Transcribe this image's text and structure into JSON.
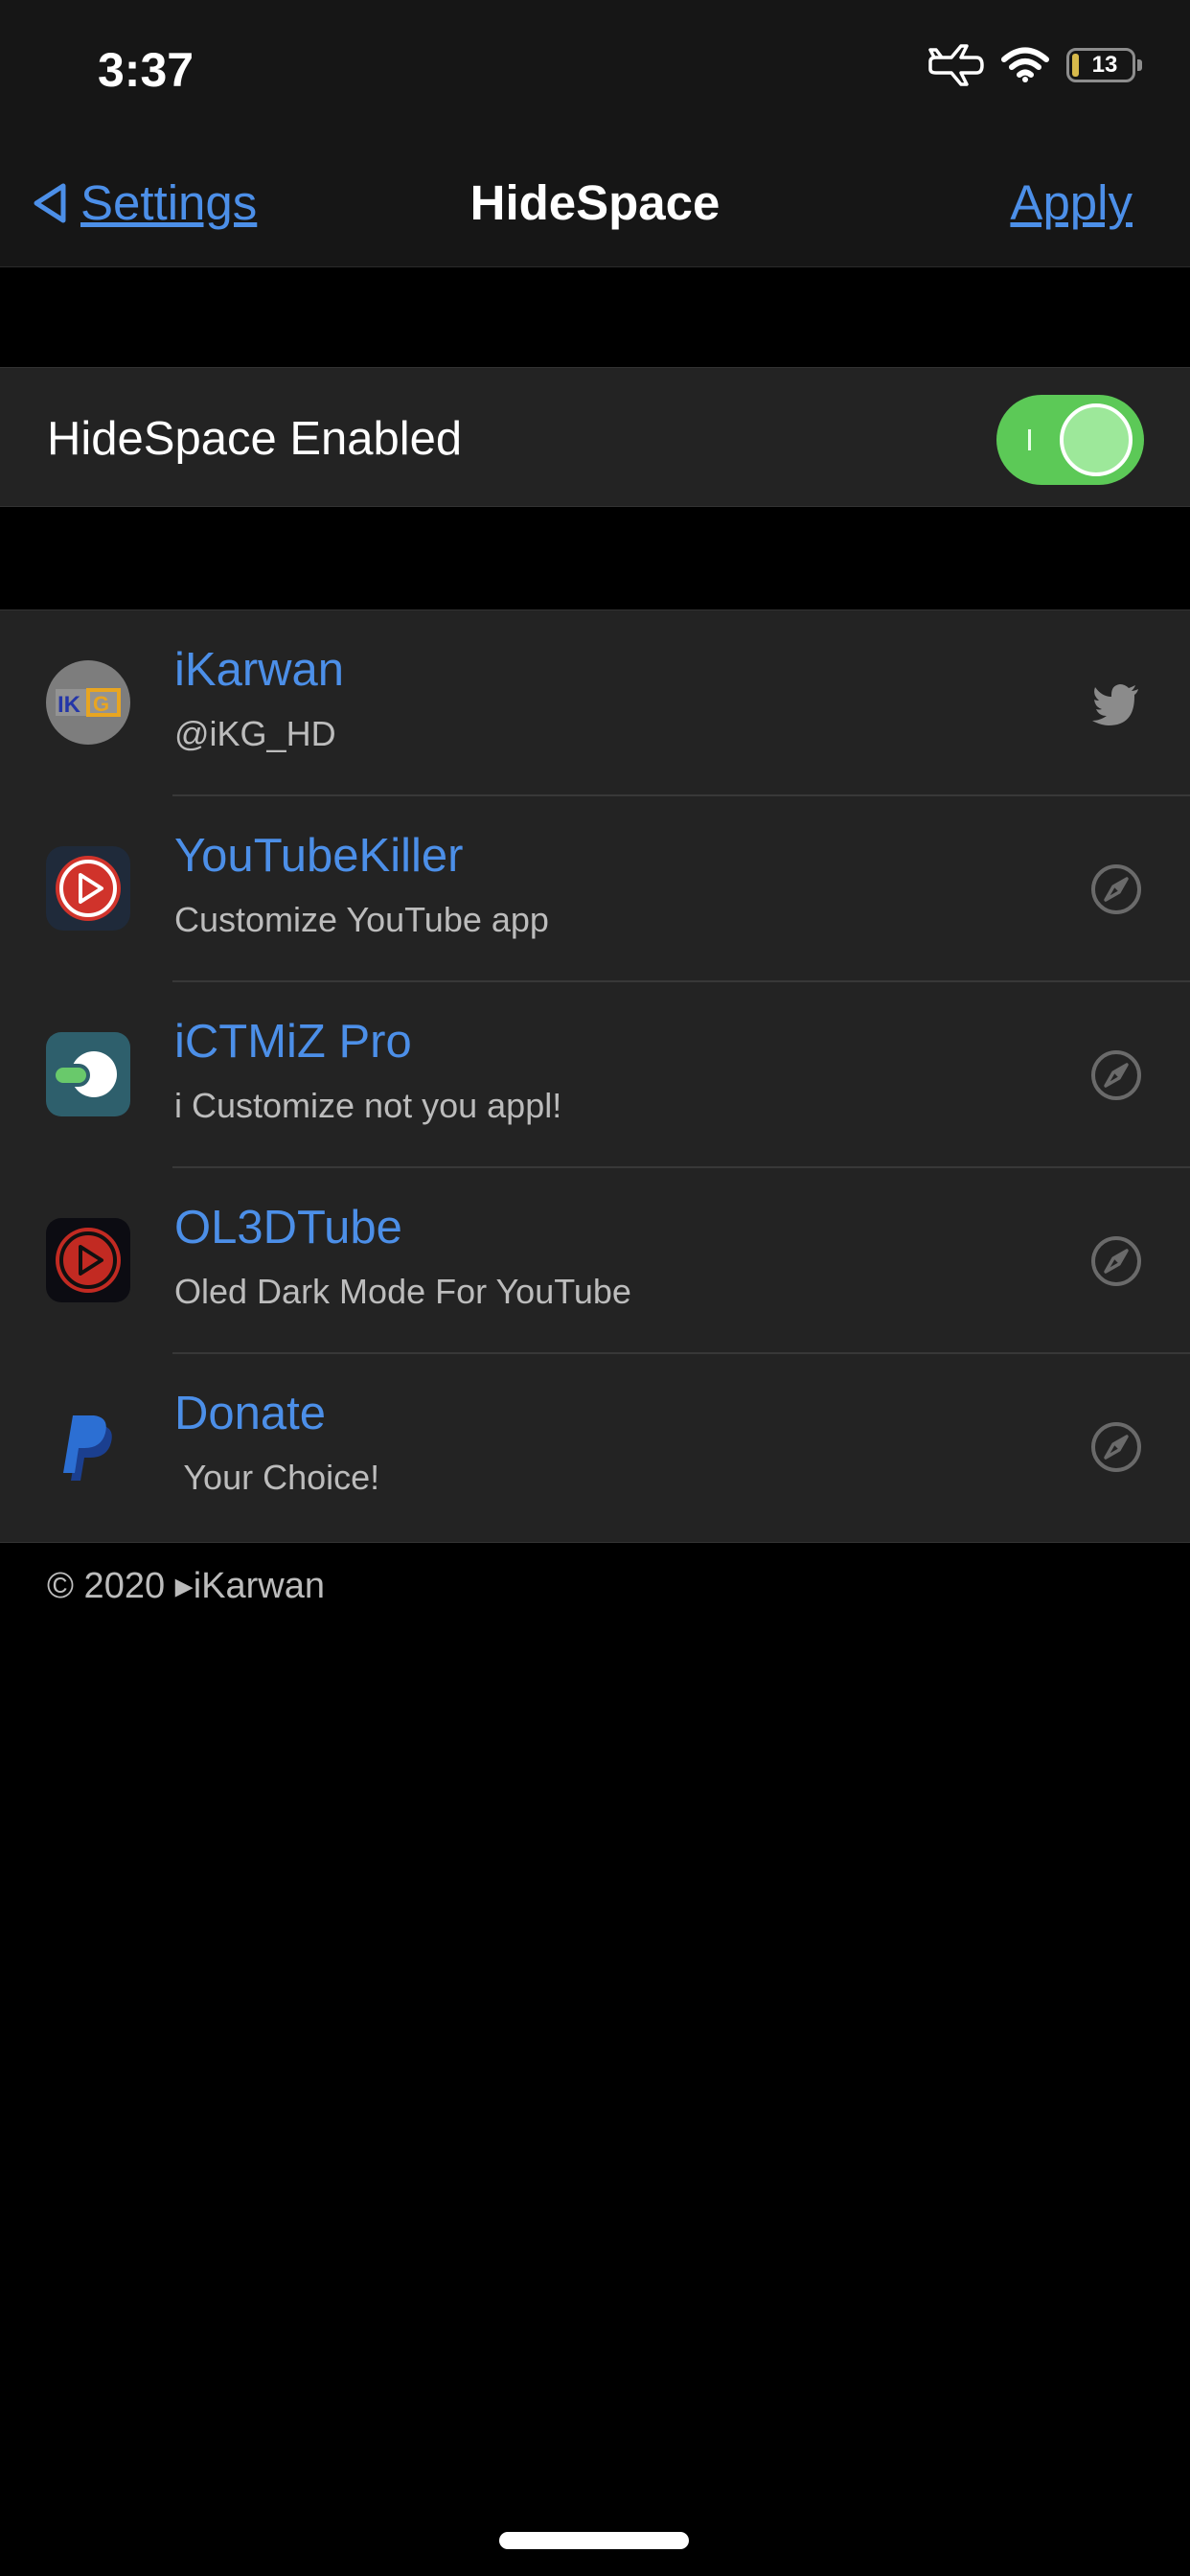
{
  "status_bar": {
    "time": "3:37",
    "battery_level": "13",
    "icons": [
      "airplane-icon",
      "wifi-icon",
      "battery-icon"
    ]
  },
  "nav": {
    "back_label": "Settings",
    "title": "HideSpace",
    "apply_label": "Apply"
  },
  "toggle": {
    "label": "HideSpace Enabled",
    "enabled": true
  },
  "rows": [
    {
      "title": "iKarwan",
      "subtitle": "@iKG_HD",
      "icon": "ikg-logo-icon",
      "action_icon": "twitter-icon"
    },
    {
      "title": "YouTubeKiller",
      "subtitle": "Customize YouTube app",
      "icon": "youtubekiller-icon",
      "action_icon": "safari-compass-icon"
    },
    {
      "title": "iCTMiZ Pro",
      "subtitle": "i Customize not you appl!",
      "icon": "ictmiz-icon",
      "action_icon": "safari-compass-icon"
    },
    {
      "title": "OL3DTube",
      "subtitle": "Oled Dark Mode For YouTube",
      "icon": "ol3dtube-icon",
      "action_icon": "safari-compass-icon"
    },
    {
      "title": "Donate",
      "subtitle": " Your Choice!",
      "icon": "paypal-icon",
      "action_icon": "safari-compass-icon"
    }
  ],
  "footer": "© 2020 ▸iKarwan",
  "colors": {
    "accent": "#4c8fe8",
    "switch_on": "#5cc957",
    "cell_bg": "#232323"
  }
}
